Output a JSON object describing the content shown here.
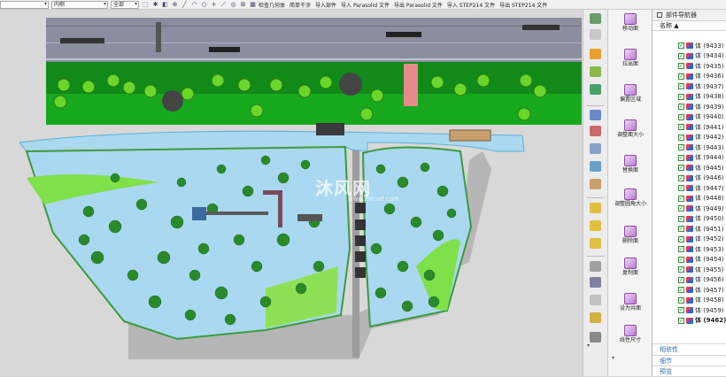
{
  "toolbar": {
    "filter_select": "",
    "scope_select": "内侧",
    "selection_select": "全部",
    "commands": [
      "检查几何体",
      "简单干涉",
      "导入部件",
      "导入 Parasolid 文件",
      "导出 Parasolid 文件",
      "导入 STEP214 文件",
      "导出 STEP214 文件"
    ]
  },
  "watermark": {
    "text": "沐风网",
    "url": "www.mfcad.com"
  },
  "commands": [
    {
      "label": "移动面"
    },
    {
      "label": "拉出面"
    },
    {
      "label": "偏置区域"
    },
    {
      "label": "调整面大小"
    },
    {
      "label": "替换面"
    },
    {
      "label": "调整圆角大小"
    },
    {
      "label": "删除面"
    },
    {
      "label": "复制面"
    },
    {
      "label": "设为共面"
    },
    {
      "label": "线性尺寸"
    }
  ],
  "navigator": {
    "title": "部件导航器",
    "column_name": "名称",
    "rows": [
      "体 (9433)",
      "体 (9434)",
      "体 (9435)",
      "体 (9436)",
      "体 (9437)",
      "体 (9438)",
      "体 (9439)",
      "体 (9440)",
      "体 (9441)",
      "体 (9442)",
      "体 (9443)",
      "体 (9444)",
      "体 (9445)",
      "体 (9446)",
      "体 (9447)",
      "体 (9448)",
      "体 (9449)",
      "体 (9450)",
      "体 (9451)",
      "体 (9452)",
      "体 (9453)",
      "体 (9454)",
      "体 (9455)",
      "体 (9456)",
      "体 (9457)",
      "体 (9458)",
      "体 (9459)",
      "体 (9462)"
    ],
    "footer": [
      "相依性",
      "细节",
      "预览"
    ]
  },
  "colors": {
    "water": "#a9d8f0",
    "grass": "#1aa22a",
    "lawn": "#58d23a",
    "road": "#8a8a9a",
    "path": "#bcbcbc"
  }
}
